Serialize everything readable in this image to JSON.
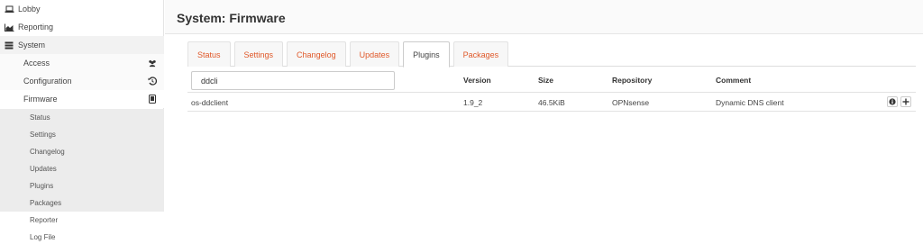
{
  "sidebar": {
    "top_items": [
      {
        "label": "Lobby",
        "icon": "laptop-icon"
      },
      {
        "label": "Reporting",
        "icon": "area-chart-icon"
      },
      {
        "label": "System",
        "icon": "server-icon"
      }
    ],
    "system_items": [
      {
        "label": "Access",
        "icon": "users-icon"
      },
      {
        "label": "Configuration",
        "icon": "history-icon"
      },
      {
        "label": "Firmware",
        "icon": "tablet-icon"
      }
    ],
    "firmware_items": [
      "Status",
      "Settings",
      "Changelog",
      "Updates",
      "Plugins",
      "Packages",
      "Reporter",
      "Log File"
    ]
  },
  "header": {
    "title": "System: Firmware"
  },
  "tabs": [
    "Status",
    "Settings",
    "Changelog",
    "Updates",
    "Plugins",
    "Packages"
  ],
  "active_tab": "Plugins",
  "search": {
    "value": "ddcli"
  },
  "table": {
    "columns": [
      "Version",
      "Size",
      "Repository",
      "Comment"
    ],
    "rows": [
      {
        "name": "os-ddclient",
        "version": "1.9_2",
        "size": "46.5KiB",
        "repository": "OPNsense",
        "comment": "Dynamic DNS client"
      }
    ]
  },
  "colors": {
    "accent": "#e0592a",
    "sidebar_highlight": "#ececec"
  }
}
